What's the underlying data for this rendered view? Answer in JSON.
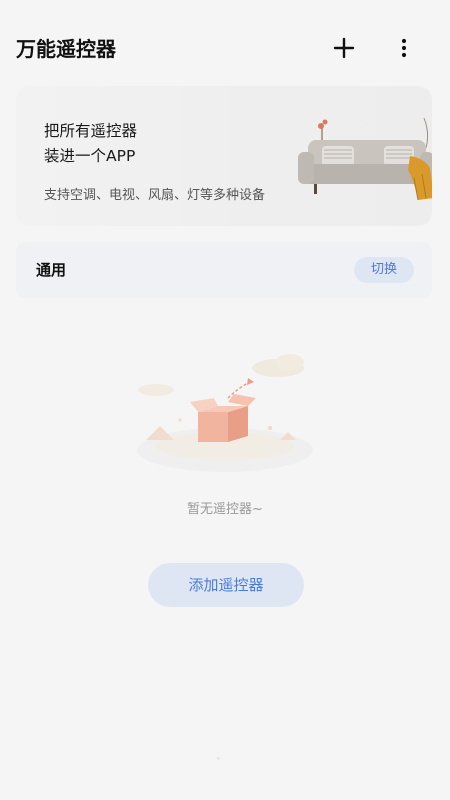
{
  "header": {
    "title": "万能遥控器",
    "add_icon": "plus-icon",
    "more_icon": "more-vertical-icon"
  },
  "banner": {
    "line1": "把所有遥控器",
    "line2": "装进一个APP",
    "subtitle": "支持空调、电视、风扇、灯等多种设备"
  },
  "group": {
    "label": "通用",
    "switch_label": "切换"
  },
  "empty_state": {
    "illustration_icon": "empty-box-icon",
    "message": "暂无遥控器~",
    "add_button_label": "添加遥控器"
  },
  "colors": {
    "background": "#f5f5f5",
    "accent": "#4a7bd8",
    "button_bg": "#dfe6f3"
  }
}
